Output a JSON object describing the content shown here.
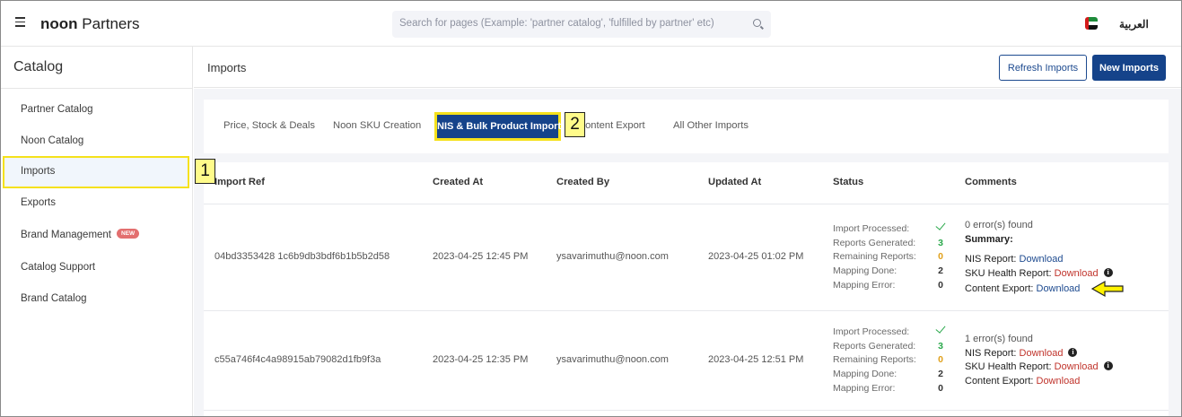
{
  "header": {
    "logo_bold": "noon",
    "logo_rest": " Partners",
    "search_placeholder": "Search for pages (Example: 'partner catalog', 'fulfilled by partner' etc)",
    "language": "العربية"
  },
  "sidebar": {
    "title": "Catalog",
    "items": [
      {
        "label": "Partner Catalog"
      },
      {
        "label": "Noon Catalog"
      },
      {
        "label": "Imports"
      },
      {
        "label": "Exports"
      },
      {
        "label": "Brand Management",
        "badge": "NEW"
      },
      {
        "label": "Catalog Support"
      },
      {
        "label": "Brand Catalog"
      }
    ],
    "active": "Imports"
  },
  "main": {
    "title": "Imports",
    "refresh_label": "Refresh Imports",
    "new_label": "New Imports"
  },
  "tabs": [
    {
      "label": "Price, Stock & Deals"
    },
    {
      "label": "Noon SKU Creation"
    },
    {
      "label": "NIS & Bulk Product Imports"
    },
    {
      "label": "Content Export"
    },
    {
      "label": "All Other Imports"
    }
  ],
  "table": {
    "headers": [
      "Import Ref",
      "Created At",
      "Created By",
      "Updated At",
      "Status",
      "Comments"
    ],
    "status_labels": [
      "Import Processed:",
      "Reports Generated:",
      "Remaining Reports:",
      "Mapping Done:",
      "Mapping Error:"
    ],
    "rows": [
      {
        "ref": "04bd3353428 1c6b9db3bdf6b1b5b2d58",
        "created_at": "2023-04-25 12:45 PM",
        "created_by": "ysavarimuthu@noon.com",
        "updated_at": "2023-04-25 01:02 PM",
        "status_values": [
          "3",
          "0",
          "2",
          "0"
        ],
        "errors": "0 error(s) found",
        "summary": "Summary:",
        "nis_label": "NIS Report:",
        "nis_link": "Download",
        "sku_label": "SKU Health Report:",
        "sku_link": "Download",
        "content_label": "Content Export:",
        "content_link": "Download"
      },
      {
        "ref": "c55a746f4c4a98915ab79082d1fb9f3a",
        "created_at": "2023-04-25 12:35 PM",
        "created_by": "ysavarimuthu@noon.com",
        "updated_at": "2023-04-25 12:51 PM",
        "status_values": [
          "3",
          "0",
          "2",
          "0"
        ],
        "errors": "1 error(s) found",
        "nis_label": "NIS Report:",
        "nis_link": "Download",
        "sku_label": "SKU Health Report:",
        "sku_link": "Download",
        "content_label": "Content Export:",
        "content_link": "Download"
      }
    ]
  },
  "annotations": {
    "marker1": "1",
    "marker2": "2"
  },
  "colors": {
    "primary": "#15438a",
    "highlight": "#f5e11b",
    "success": "#2aa84b",
    "warning": "#e0a01a",
    "link_red": "#c0332b"
  }
}
